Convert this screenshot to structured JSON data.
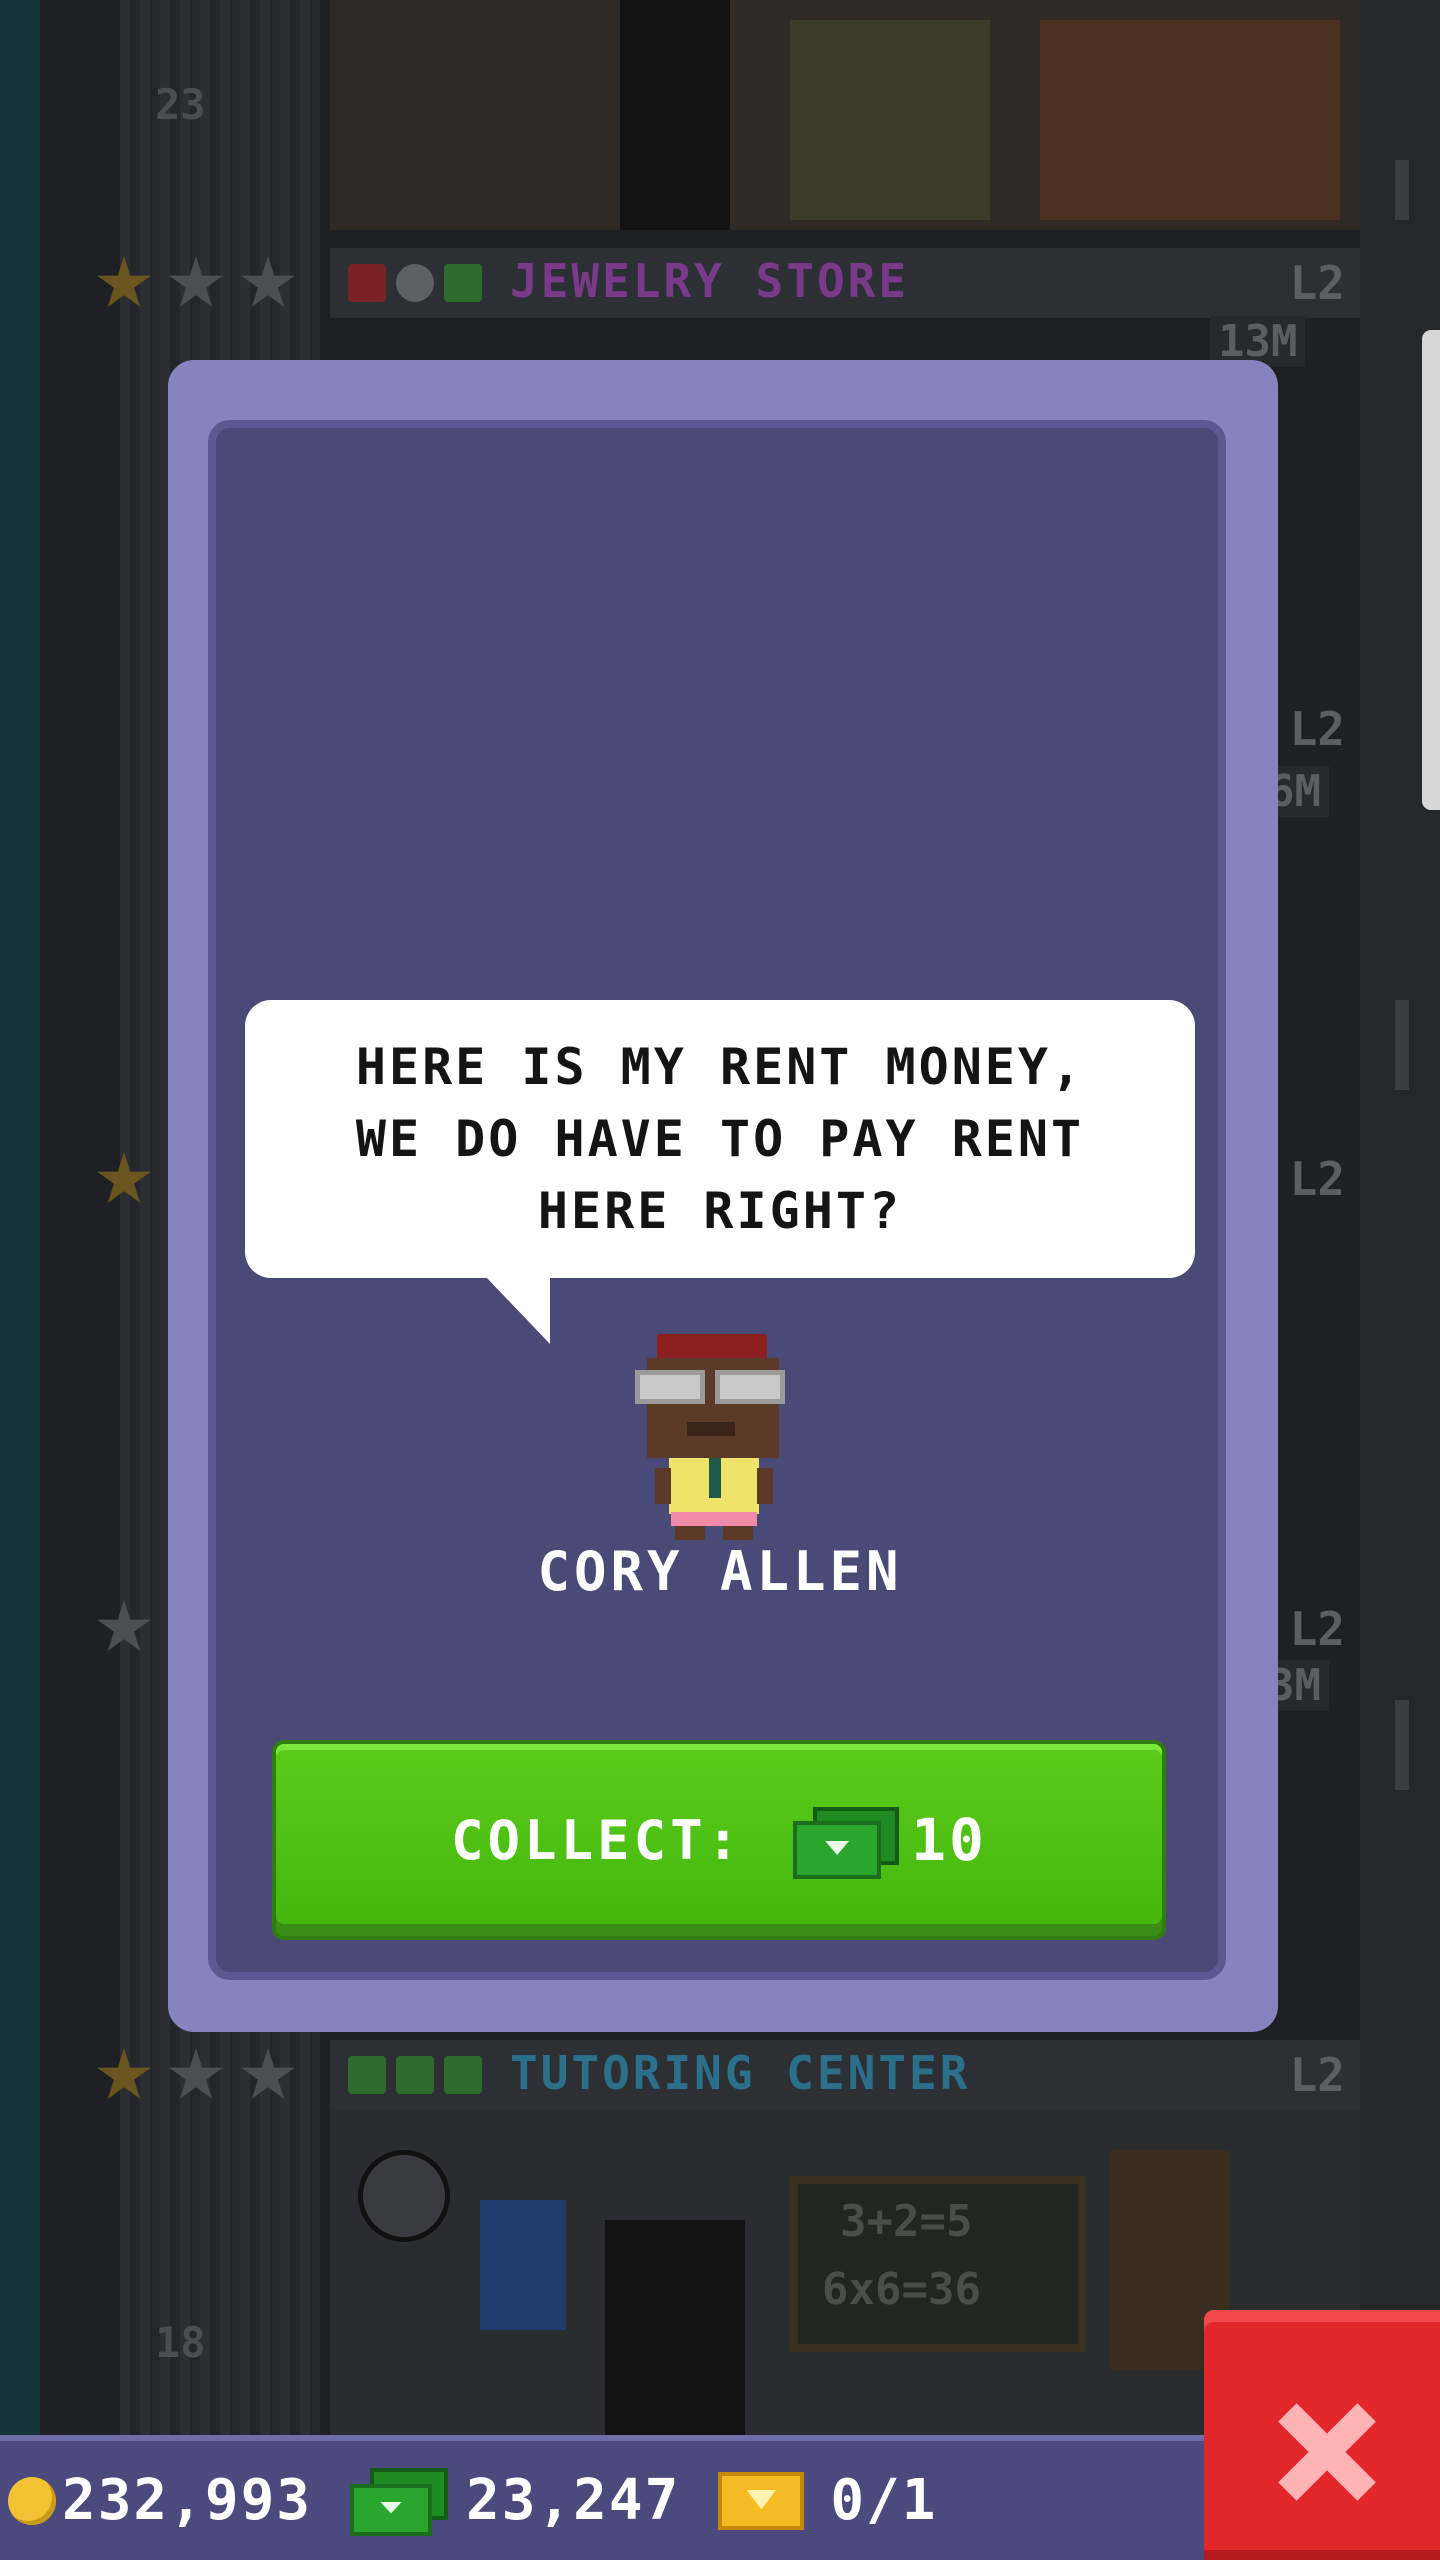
{
  "background": {
    "floors": [
      {
        "name": "JEWELRY STORE",
        "level": "L2",
        "name_color": "#7a3a8a"
      },
      {
        "name": "TUTORING CENTER",
        "level": "L2",
        "name_color": "#2b6f8a"
      }
    ],
    "floor_numbers": [
      "23",
      "18"
    ],
    "side_levels": [
      "L2",
      "L2",
      "L2"
    ],
    "prices": [
      "13M",
      "6M",
      "3M"
    ],
    "chalkboard": [
      "3+2=5",
      "6x6=36"
    ]
  },
  "dialog": {
    "speech": "HERE IS MY RENT MONEY,\nWE DO HAVE TO PAY RENT\nHERE RIGHT?",
    "character_name": "CORY ALLEN",
    "collect_label": "COLLECT:",
    "collect_amount": "10",
    "collect_icon": "bux-icon"
  },
  "hud": {
    "coins": "232,993",
    "bux": "23,247",
    "tickets": "0/1"
  },
  "close_button": {
    "icon": "close-icon"
  },
  "colors": {
    "dialog_border": "#8783bf",
    "dialog_fill": "#4a4a77",
    "collect_button": "#4cc014",
    "close_button": "#e2272b",
    "hud_bar": "#4c4a7c"
  }
}
